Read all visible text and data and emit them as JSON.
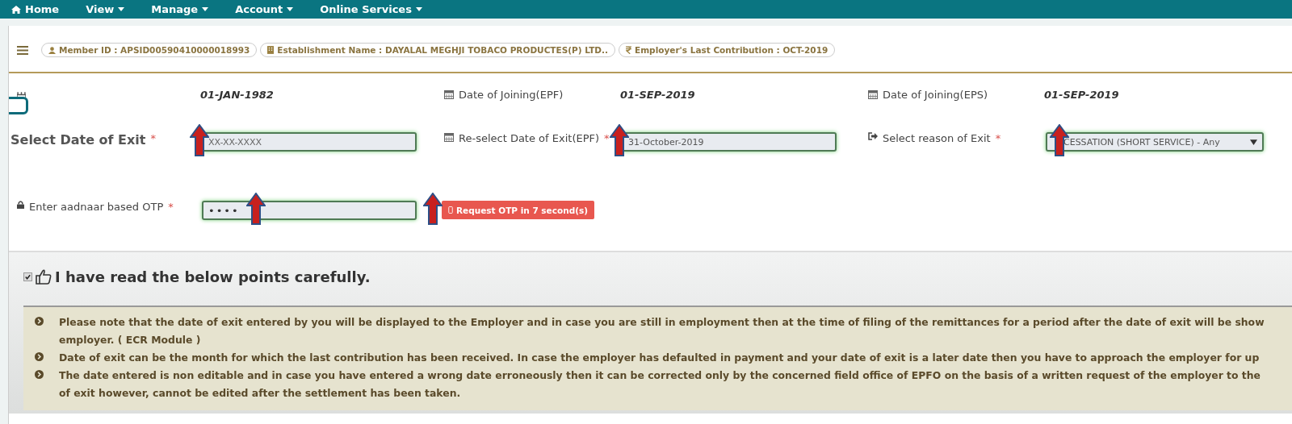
{
  "nav": [
    {
      "label": "Home",
      "dropdown": false
    },
    {
      "label": "View",
      "dropdown": true
    },
    {
      "label": "Manage",
      "dropdown": true
    },
    {
      "label": "Account",
      "dropdown": true
    },
    {
      "label": "Online Services",
      "dropdown": true
    }
  ],
  "info_pills": [
    {
      "text": "Member ID : APSID00590410000018993"
    },
    {
      "text": "Establishment Name : DAYALAL MEGHJI TOBACO PRODUCTES(P) LTD.."
    },
    {
      "text": "Employer's Last Contribution : OCT-2019"
    }
  ],
  "dates": [
    {
      "value": "01-JAN-1982"
    },
    {
      "label": "Date of Joining(EPF)",
      "value": "01-SEP-2019"
    },
    {
      "label": "Date of Joining(EPS)",
      "value": "01-SEP-2019"
    }
  ],
  "fields": [
    {
      "kind": "date",
      "label": "Select Date of Exit",
      "required_mark": "*",
      "placeholder": "XX-XX-XXXX"
    },
    {
      "kind": "date",
      "label": "Re-select Date of Exit(EPF)",
      "required_mark": "*",
      "value": "31-October-2019"
    },
    {
      "kind": "select",
      "label": "Select reason of Exit",
      "required_mark": "*",
      "value": "CESSATION (SHORT SERVICE) - Any"
    }
  ],
  "otp": {
    "label": "Enter aadnaar based OTP",
    "required_mark": "*",
    "value": "••••",
    "button": {
      "label": "Request OTP in 7 second(s)",
      "disabled": true
    }
  },
  "agreement": {
    "checked": true,
    "label": "I have read the below points carefully."
  },
  "notes": [
    [
      "Please note that the date of exit entered by you will be displayed to the Employer and in case you are still in employment then at the time of filing of the remittances for a period after the date of exit will be show",
      "employer. ( ECR Module )"
    ],
    [
      "Date of exit can be the month for which the last contribution has been received. In case the employer has defaulted in payment and your date of exit is a later date then you have to approach the employer for up"
    ],
    [
      "The date entered is non editable and in case you have entered a wrong date erroneously then it can be corrected only by the concerned field office of EPFO on the basis of a written request of the employer to the",
      "of exit however, cannot be edited after the settlement has been taken."
    ]
  ]
}
